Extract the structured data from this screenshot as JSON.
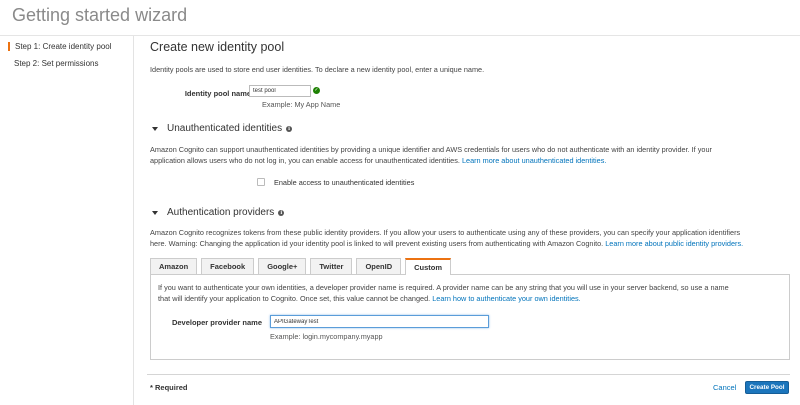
{
  "wizard": {
    "title": "Getting started wizard"
  },
  "steps": [
    {
      "label": "Step 1: Create identity pool",
      "active": true
    },
    {
      "label": "Step 2: Set permissions",
      "active": false
    }
  ],
  "page": {
    "title": "Create new identity pool",
    "description": "Identity pools are used to store end user identities. To declare a new identity pool, enter a unique name."
  },
  "pool_name": {
    "label": "Identity pool name*",
    "value": "test pool",
    "example": "Example: My App Name"
  },
  "unauth": {
    "title": "Unauthenticated identities",
    "text_line1": "Amazon Cognito can support unauthenticated identities by providing a unique identifier and AWS credentials for users who do not authenticate with an identity provider. If your",
    "text_line2": "application allows users who do not log in, you can enable access for unauthenticated identities.",
    "link": "Learn more about unauthenticated identities.",
    "checkbox_label": "Enable access to unauthenticated identities",
    "checked": false
  },
  "auth": {
    "title": "Authentication providers",
    "text_line1": "Amazon Cognito recognizes tokens from these public identity providers. If you allow your users to authenticate using any of these providers, you can specify your application identifiers",
    "text_line2": "here. Warning: Changing the application id your identity pool is linked to will prevent existing users from authenticating with Amazon Cognito.",
    "link": "Learn more about public identity providers.",
    "tabs": [
      {
        "label": "Amazon",
        "active": false
      },
      {
        "label": "Facebook",
        "active": false
      },
      {
        "label": "Google+",
        "active": false
      },
      {
        "label": "Twitter",
        "active": false
      },
      {
        "label": "OpenID",
        "active": false
      },
      {
        "label": "Custom",
        "active": true
      }
    ],
    "custom": {
      "text_line1": "If you want to authenticate your own identities, a developer provider name is required. A provider name can be any string that you will use in your server backend, so use a name",
      "text_line2": "that will identify your application to Cognito. Once set, this value cannot be changed.",
      "link": "Learn how to authenticate your own identities.",
      "field_label": "Developer provider name",
      "field_value": "APIGatewayTest",
      "example": "Example: login.mycompany.myapp"
    }
  },
  "footer": {
    "required": "* Required",
    "cancel": "Cancel",
    "create": "Create Pool"
  },
  "colors": {
    "accent": "#ec7211",
    "link": "#0073bb",
    "primary": "#1b75bc",
    "success": "#1d8102"
  },
  "icons": {
    "caret": "caret-down-icon",
    "info": "info-icon",
    "ok": "check-circle-icon"
  }
}
